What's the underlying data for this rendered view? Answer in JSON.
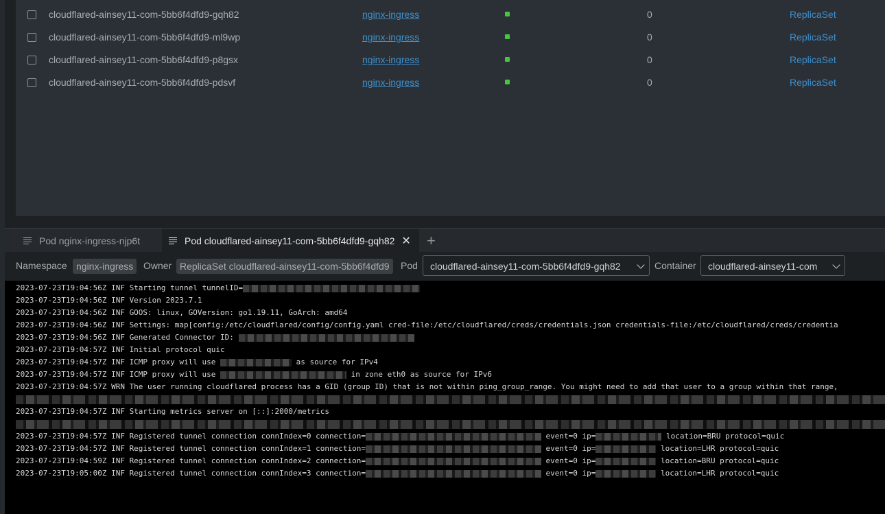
{
  "pods": [
    {
      "name": "cloudflared-ainsey11-com-5bb6f4dfd9-gqh82",
      "namespace": "nginx-ingress",
      "restarts": "0",
      "owner": "ReplicaSet"
    },
    {
      "name": "cloudflared-ainsey11-com-5bb6f4dfd9-ml9wp",
      "namespace": "nginx-ingress",
      "restarts": "0",
      "owner": "ReplicaSet"
    },
    {
      "name": "cloudflared-ainsey11-com-5bb6f4dfd9-p8gsx",
      "namespace": "nginx-ingress",
      "restarts": "0",
      "owner": "ReplicaSet"
    },
    {
      "name": "cloudflared-ainsey11-com-5bb6f4dfd9-pdsvf",
      "namespace": "nginx-ingress",
      "restarts": "0",
      "owner": "ReplicaSet"
    }
  ],
  "colors": {
    "status_running": "#48c53f",
    "link": "#3d90ce"
  },
  "tabs": [
    {
      "label": "Pod nginx-ingress-njp6t",
      "icon": "log-lines-icon"
    },
    {
      "label": "Pod cloudflared-ainsey11-com-5bb6f4dfd9-gqh82",
      "icon": "log-lines-icon",
      "active": true
    }
  ],
  "toolbar": {
    "namespace_label": "Namespace",
    "namespace_value": "nginx-ingress",
    "owner_label": "Owner",
    "owner_value": "ReplicaSet cloudflared-ainsey11-com-5bb6f4dfd9",
    "pod_label": "Pod",
    "pod_value": "cloudflared-ainsey11-com-5bb6f4dfd9-gqh82",
    "container_label": "Container",
    "container_value": "cloudflared-ainsey11-com"
  },
  "log": {
    "l1a": "2023-07-23T19:04:56Z INF Starting tunnel tunnelID=",
    "l2": "2023-07-23T19:04:56Z INF Version 2023.7.1",
    "l3": "2023-07-23T19:04:56Z INF GOOS: linux, GOVersion: go1.19.11, GoArch: amd64",
    "l4": "2023-07-23T19:04:56Z INF Settings: map[config:/etc/cloudflared/config/config.yaml cred-file:/etc/cloudflared/creds/credentials.json credentials-file:/etc/cloudflared/creds/credentia",
    "l5a": "2023-07-23T19:04:56Z INF Generated Connector ID: ",
    "l6": "2023-07-23T19:04:57Z INF Initial protocol quic",
    "l7a": "2023-07-23T19:04:57Z INF ICMP proxy will use ",
    "l7b": " as source for IPv4",
    "l8a": "2023-07-23T19:04:57Z INF ICMP proxy will use ",
    "l8b": " in zone eth0 as source for IPv6",
    "l9": "2023-07-23T19:04:57Z WRN The user running cloudflared process has a GID (group ID) that is not within ping_group_range. You might need to add that user to a group within that range,",
    "l10": "2023-07-23T19:04:57Z INF Starting metrics server on [::]:2000/metrics",
    "conns": [
      {
        "a": "2023-07-23T19:04:57Z INF Registered tunnel connection connIndex=0 connection=",
        "b": " event=0 ip=",
        "c": " location=BRU protocol=quic"
      },
      {
        "a": "2023-07-23T19:04:57Z INF Registered tunnel connection connIndex=1 connection=",
        "b": " event=0 ip=",
        "c": " location=LHR protocol=quic"
      },
      {
        "a": "2023-07-23T19:04:59Z INF Registered tunnel connection connIndex=2 connection=",
        "b": " event=0 ip=",
        "c": " location=BRU protocol=quic"
      },
      {
        "a": "2023-07-23T19:05:00Z INF Registered tunnel connection connIndex=3 connection=",
        "b": " event=0 ip=",
        "c": " location=LHR protocol=quic"
      }
    ]
  }
}
